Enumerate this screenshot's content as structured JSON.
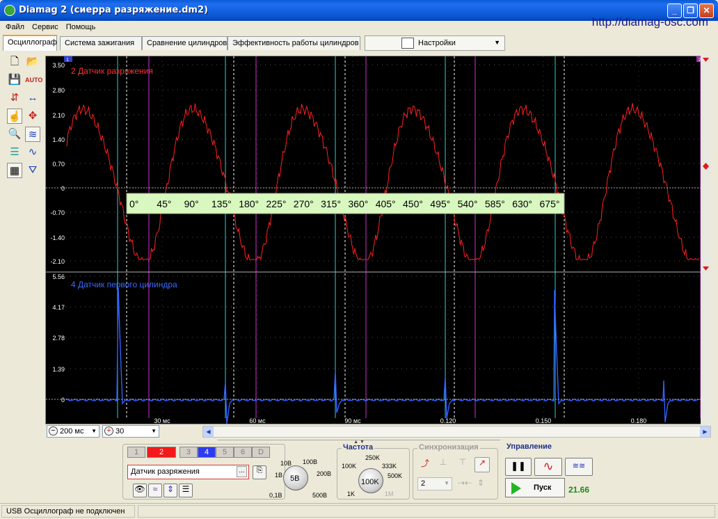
{
  "window": {
    "title": "Diamag 2 (сиерра разряжение.dm2)",
    "url": "http://diamag-osc.com",
    "controls": [
      "_",
      "❐",
      "✕"
    ]
  },
  "menu": [
    "Файл",
    "Сервис",
    "Помощь"
  ],
  "tabs": [
    {
      "label": "Осциллограф",
      "active": true
    },
    {
      "label": "Система зажигания",
      "active": false
    },
    {
      "label": "Сравнение цилиндров",
      "active": false
    },
    {
      "label": "Эффективность работы цилиндров",
      "active": false
    }
  ],
  "settings_dropdown": {
    "label": "Настройки",
    "icon": "gear-page-icon"
  },
  "toolbar_icons": [
    "new-file-icon",
    "open-folder-icon",
    "save-icon",
    "auto-icon",
    "cursor-measure-icon",
    "horizontal-measure-icon",
    "hand-icon",
    "vertical-scale-icon",
    "zoom-icon",
    "signal-compare-icon",
    "layers-icon",
    "multi-signal-icon",
    "table-icon",
    "filter-icon"
  ],
  "scope": {
    "colors": {
      "channel2": "#ff2020",
      "channel4": "#3060ff",
      "cyan_marker": "#30d0d0",
      "magenta_marker": "#d030d0",
      "white_marker": "#ffffff",
      "axis_text": "#ffffff"
    },
    "top": {
      "label": "2 Датчик разряжения",
      "y_ticks": [
        "3.50",
        "2.80",
        "2.10",
        "1.40",
        "0.70",
        "0",
        "-0.70",
        "-1.40",
        "-2.10"
      ]
    },
    "bottom": {
      "label": "4 Датчик первого цилиндра",
      "y_ticks": [
        "5.56",
        "4.17",
        "2.78",
        "1.39",
        "0"
      ]
    },
    "x_ticks": [
      "30 мс",
      "60 мс",
      "90 мс",
      "0.120",
      "0.150",
      "0.180"
    ],
    "marker_top_left": "1",
    "marker_top_right": "2",
    "degree_scale": [
      "0°",
      "45°",
      "90°",
      "135°",
      "180°",
      "225°",
      "270°",
      "315°",
      "360°",
      "405°",
      "450°",
      "495°",
      "540°",
      "585°",
      "630°",
      "675°"
    ]
  },
  "navbar": {
    "timebase": "200",
    "timebase_unit": "мс",
    "zoom": "30"
  },
  "channels": {
    "buttons": [
      "1",
      "2",
      "3",
      "4",
      "5",
      "6",
      "D"
    ],
    "active_red": "2",
    "active_blue": "4",
    "sensor": "Датчик разряжения",
    "sensor_btn": "..."
  },
  "voltage_knob": {
    "value": "5В",
    "labels": [
      "10В",
      "100В",
      "1В",
      "200В",
      "0,1В",
      "500В"
    ]
  },
  "frequency": {
    "title": "Частота",
    "value": "100K",
    "labels": [
      "250K",
      "100K",
      "333K",
      "500K",
      "1K",
      "1M"
    ]
  },
  "sync": {
    "title": "Синхронизация",
    "channel": "2"
  },
  "control": {
    "title": "Управление",
    "run_label": "Пуск",
    "fps": "21.66"
  },
  "status": "USB Осциллограф не подключен"
}
